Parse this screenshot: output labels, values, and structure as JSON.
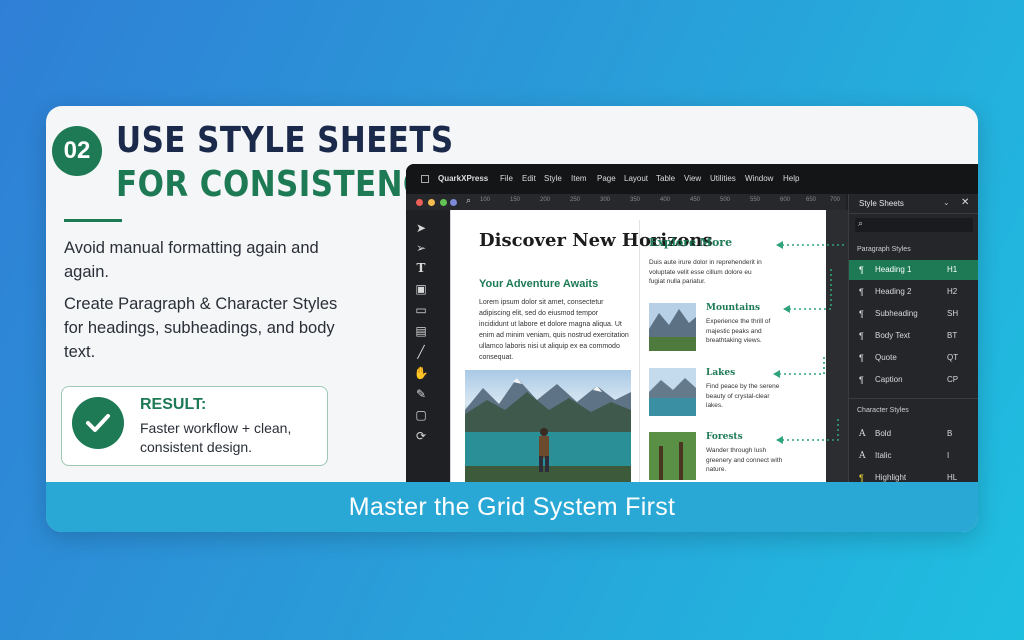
{
  "step": {
    "number": "02"
  },
  "heading": {
    "line1": "USE STYLE SHEETS",
    "line2": "FOR CONSISTENCY"
  },
  "paragraphs": [
    "Avoid manual formatting again and again.",
    "Create Paragraph & Character Styles for headings, subheadings, and body text."
  ],
  "result": {
    "label": "RESULT:",
    "text": "Faster workflow + clean, consistent design."
  },
  "banner": "Master the Grid System First",
  "app": {
    "name": "QuarkXPress",
    "menus": [
      "File",
      "Edit",
      "Style",
      "Item",
      "Page",
      "Layout",
      "Table",
      "View",
      "Utilities",
      "Window",
      "Help"
    ],
    "ruler": [
      "100",
      "150",
      "200",
      "250",
      "300",
      "350",
      "400",
      "450",
      "500",
      "550",
      "600",
      "650",
      "700"
    ]
  },
  "document": {
    "headline": "Discover New Horizons",
    "subheadline": "Your Adventure Awaits",
    "body": "Lorem ipsum dolor sit amet, consectetur adipiscing elit, sed do eiusmod tempor incididunt ut labore et dolore magna aliqua. Ut enim ad minim veniam, quis nostrud exercitation ullamco laboris nisi ut aliquip ex ea commodo consequat.",
    "explore_title": "Explore More",
    "explore_text": "Duis aute irure dolor in reprehenderit in voluptate velit esse cillum dolore eu fugiat nulla pariatur.",
    "items": [
      {
        "title": "Mountains",
        "desc": "Experience the thrill of majestic peaks and breathtaking views."
      },
      {
        "title": "Lakes",
        "desc": "Find peace by the serene beauty of crystal-clear lakes."
      },
      {
        "title": "Forests",
        "desc": "Wander through lush greenery and connect with nature."
      }
    ]
  },
  "style_panel": {
    "title": "Style Sheets",
    "paragraph_section": "Paragraph Styles",
    "paragraph_styles": [
      {
        "name": "Heading 1",
        "shortcut": "H1",
        "icon": "¶"
      },
      {
        "name": "Heading 2",
        "shortcut": "H2",
        "icon": "¶"
      },
      {
        "name": "Subheading",
        "shortcut": "SH",
        "icon": "¶"
      },
      {
        "name": "Body Text",
        "shortcut": "BT",
        "icon": "¶"
      },
      {
        "name": "Quote",
        "shortcut": "QT",
        "icon": "¶"
      },
      {
        "name": "Caption",
        "shortcut": "CP",
        "icon": "¶"
      }
    ],
    "character_section": "Character Styles",
    "character_styles": [
      {
        "name": "Bold",
        "shortcut": "B",
        "icon": "A"
      },
      {
        "name": "Italic",
        "shortcut": "I",
        "icon": "A"
      },
      {
        "name": "Highlight",
        "shortcut": "HL",
        "icon": "¶"
      }
    ]
  },
  "colors": {
    "accent": "#1d7a55",
    "banner": "#29a8d6",
    "navy": "#1b2a4a"
  }
}
